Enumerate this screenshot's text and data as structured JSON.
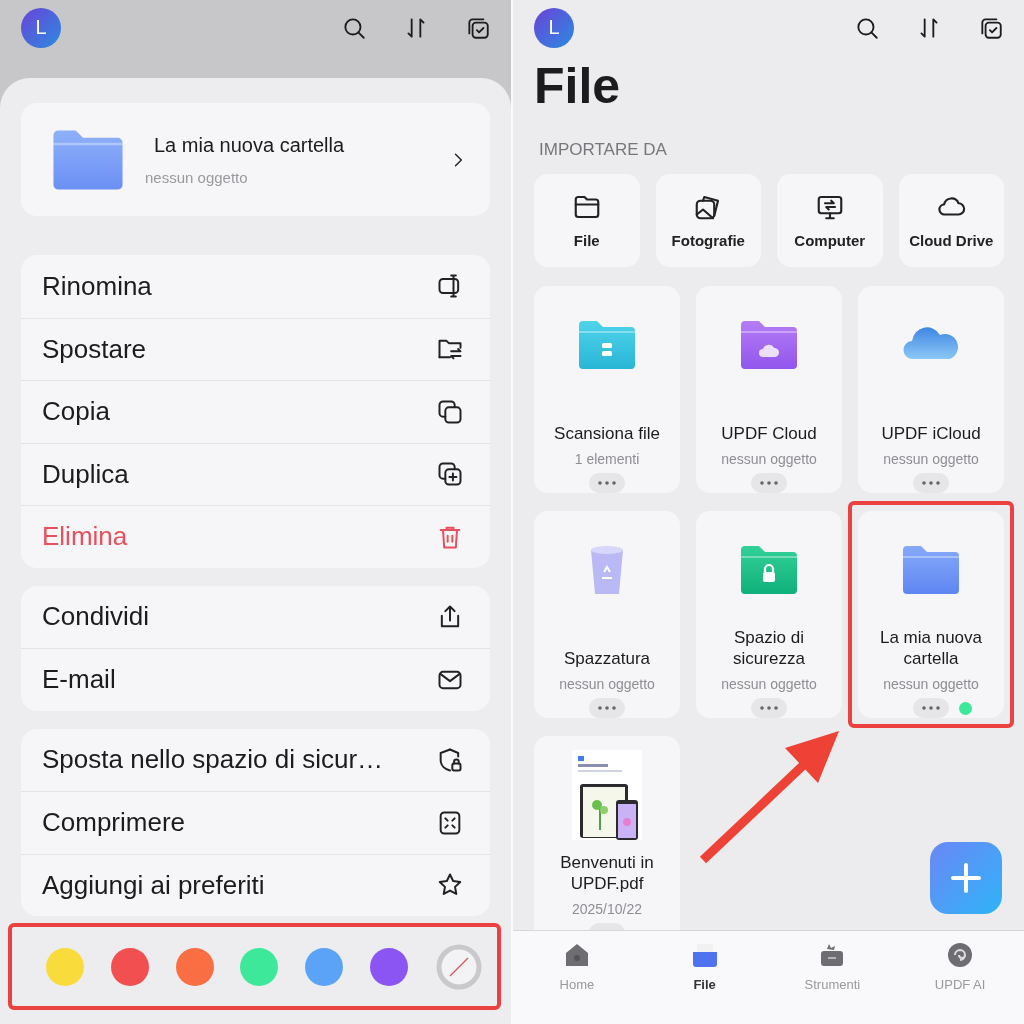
{
  "sheet_screen": {
    "avatar": "L",
    "header": {
      "name": "La mia nuova cartella",
      "subtitle": "nessun oggetto"
    },
    "menu_groups": [
      {
        "items": [
          {
            "label": "Rinomina",
            "destructive": false
          },
          {
            "label": "Spostare",
            "destructive": false
          },
          {
            "label": "Copia",
            "destructive": false
          },
          {
            "label": "Duplica",
            "destructive": false
          },
          {
            "label": "Elimina",
            "destructive": true
          }
        ]
      },
      {
        "items": [
          {
            "label": "Condividi",
            "destructive": false
          },
          {
            "label": "E-mail",
            "destructive": false
          }
        ]
      },
      {
        "items": [
          {
            "label": "Sposta nello spazio di sicur…",
            "destructive": false
          },
          {
            "label": "Comprimere",
            "destructive": false
          },
          {
            "label": "Aggiungi ai preferiti",
            "destructive": false
          }
        ]
      }
    ],
    "palette": {
      "highlighted": true,
      "swatches": [
        {
          "kind": "color",
          "color": "#f9dc3c"
        },
        {
          "kind": "color",
          "color": "#f25050"
        },
        {
          "kind": "color",
          "color": "#f96f43"
        },
        {
          "kind": "color",
          "color": "#3ee89a"
        },
        {
          "kind": "color",
          "color": "#5aa3f7"
        },
        {
          "kind": "color",
          "color": "#8b55f4"
        },
        {
          "kind": "none"
        }
      ]
    }
  },
  "files_screen": {
    "avatar": "L",
    "title": "File",
    "section_label": "IMPORTARE DA",
    "import_sources": [
      {
        "label": "File"
      },
      {
        "label": "Fotografie"
      },
      {
        "label": "Computer"
      },
      {
        "label": "Cloud Drive"
      }
    ],
    "items": [
      {
        "name": "Scansiona file",
        "subtitle": "1 elementi",
        "highlighted": false
      },
      {
        "name": "UPDF Cloud",
        "subtitle": "nessun oggetto",
        "highlighted": false
      },
      {
        "name": "UPDF iCloud",
        "subtitle": "nessun oggetto",
        "highlighted": false
      },
      {
        "name": "Spazzatura",
        "subtitle": "nessun oggetto",
        "highlighted": false
      },
      {
        "name": "Spazio di sicurezza",
        "subtitle": "nessun oggetto",
        "highlighted": false
      },
      {
        "name": "La mia nuova cartella",
        "subtitle": "nessun oggetto",
        "highlighted": true,
        "color": "#3ee89a"
      },
      {
        "name": "Benvenuti in UPDF.pdf",
        "subtitle": "2025/10/22",
        "highlighted": false
      }
    ],
    "tabs": [
      {
        "label": "Home",
        "selected": false
      },
      {
        "label": "File",
        "selected": true
      },
      {
        "label": "Strumenti",
        "selected": false
      },
      {
        "label": "UPDF AI",
        "selected": false
      }
    ]
  }
}
